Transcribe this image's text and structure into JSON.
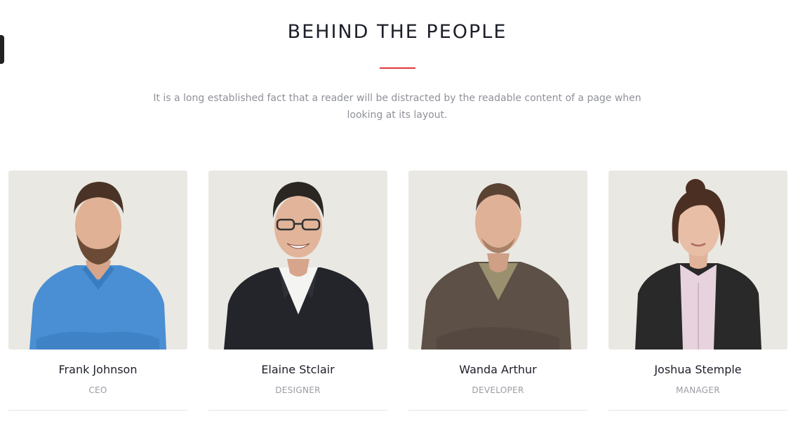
{
  "section": {
    "title": "BEHIND THE PEOPLE",
    "description": "It is a long established fact that a reader will be distracted by the readable content of a page when looking at its layout."
  },
  "colors": {
    "accent": "#e0383c",
    "title": "#1d1f2a",
    "muted": "#8f9199",
    "photo_bg": "#e9e8e3"
  },
  "team": [
    {
      "name": "Frank Johnson",
      "role": "CEO",
      "portrait": "man-blue-shirt-portrait"
    },
    {
      "name": "Elaine Stclair",
      "role": "DESIGNER",
      "portrait": "man-suit-glasses-portrait"
    },
    {
      "name": "Wanda Arthur",
      "role": "DEVELOPER",
      "portrait": "man-cardigan-portrait"
    },
    {
      "name": "Joshua Stemple",
      "role": "MANAGER",
      "portrait": "woman-blazer-portrait"
    }
  ]
}
